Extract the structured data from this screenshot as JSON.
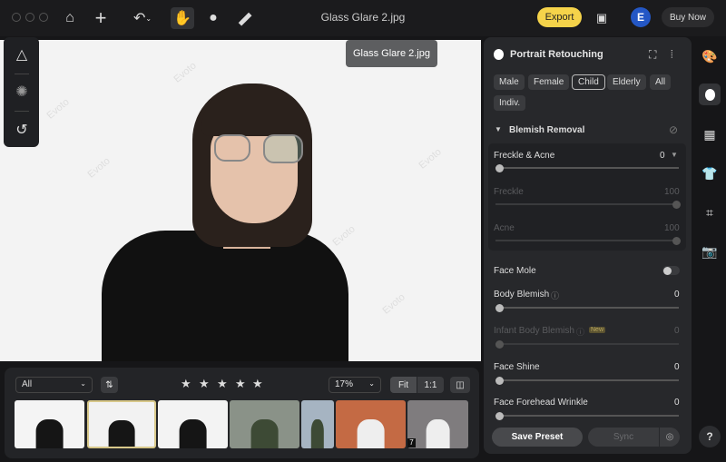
{
  "window": {
    "title": "Glass Glare 2.jpg",
    "tooltip": "Glass Glare 2.jpg"
  },
  "toolbar": {
    "icons": [
      "home-icon",
      "plus-icon",
      "undo-icon",
      "hand-icon",
      "face-brush-icon",
      "bandage-icon"
    ],
    "export_label": "Export",
    "avatar_letter": "E",
    "buy_label": "Buy Now"
  },
  "canvas": {
    "watermark": "Evoto"
  },
  "palette": {
    "icons": [
      "landscape-icon",
      "mask-icon",
      "history-icon"
    ]
  },
  "filmstrip": {
    "filter": "All",
    "stars": [
      "★",
      "★",
      "★",
      "★",
      "★"
    ],
    "zoom": "17%",
    "fit": "Fit",
    "one_to_one": "1:1",
    "badge": "7",
    "thumbs": [
      {
        "bg": "#f4f4f4"
      },
      {
        "bg": "#f2f2f2",
        "selected": true
      },
      {
        "bg": "#f3f3f3"
      },
      {
        "bg": "#8a9288"
      },
      {
        "bg": "#a6b4c2"
      },
      {
        "bg": "#c46a44"
      },
      {
        "bg": "#7f7c7e"
      }
    ]
  },
  "panel": {
    "title": "Portrait Retouching",
    "chips": [
      "Male",
      "Female",
      "Child",
      "Elderly",
      "All",
      "Indiv."
    ],
    "active_chip": "Child",
    "section": "Blemish Removal",
    "freckle_acne": {
      "label": "Freckle & Acne",
      "value": "0"
    },
    "freckle": {
      "label": "Freckle",
      "value": "100"
    },
    "acne": {
      "label": "Acne",
      "value": "100"
    },
    "face_mole": {
      "label": "Face Mole",
      "on": false
    },
    "body_blemish": {
      "label": "Body Blemish",
      "value": "0"
    },
    "infant": {
      "label": "Infant Body Blemish",
      "badge": "New",
      "value": "0"
    },
    "face_shine": {
      "label": "Face Shine",
      "value": "0"
    },
    "wrinkle": {
      "label": "Face Forehead Wrinkle",
      "value": "0"
    },
    "save_preset": "Save Preset",
    "sync": "Sync"
  },
  "right_column": {
    "icons": [
      "palette-icon",
      "face-icon",
      "gradient-icon",
      "shirt-icon",
      "crop-icon",
      "camera-icon"
    ],
    "help": "?"
  },
  "colors": {
    "accent": "#f5d34a",
    "panel": "#27282b",
    "avatar": "#2457c5"
  }
}
